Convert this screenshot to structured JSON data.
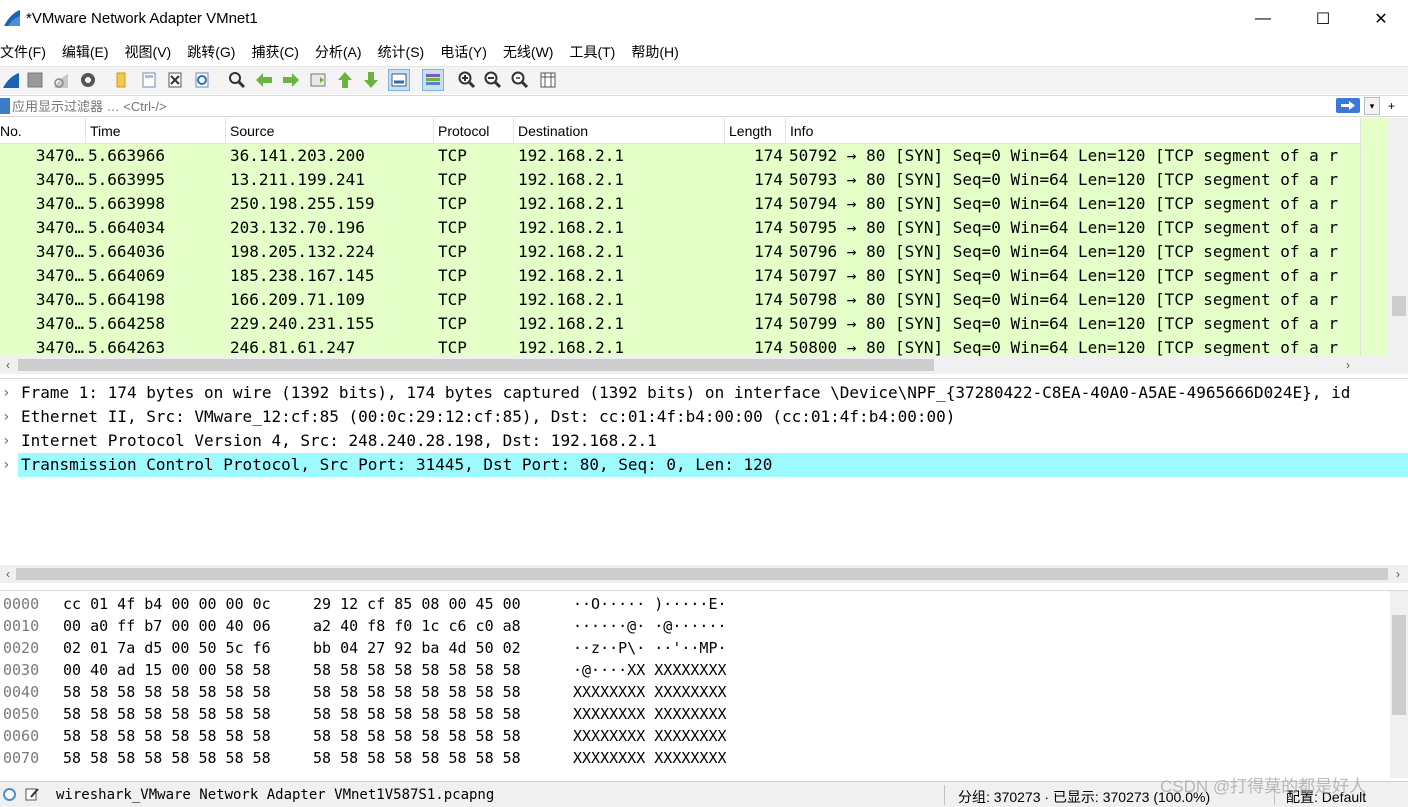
{
  "window": {
    "title": "*VMware Network Adapter VMnet1",
    "minimize": "—",
    "maximize": "☐",
    "close": "✕"
  },
  "menu": [
    "文件(F)",
    "编辑(E)",
    "视图(V)",
    "跳转(G)",
    "捕获(C)",
    "分析(A)",
    "统计(S)",
    "电话(Y)",
    "无线(W)",
    "工具(T)",
    "帮助(H)"
  ],
  "toolbar": {
    "icons": [
      "shark-fin-start-icon",
      "stop-square-icon",
      "restart-fin-icon",
      "capture-options-gear-icon",
      "open-folder-icon",
      "save-file-icon",
      "close-file-icon",
      "reload-icon",
      "find-packet-icon",
      "go-back-icon",
      "go-forward-icon",
      "go-to-packet-icon",
      "go-first-icon",
      "go-last-icon",
      "auto-scroll-icon",
      "colorize-icon",
      "zoom-in-icon",
      "zoom-out-icon",
      "normal-size-icon",
      "resize-columns-icon"
    ]
  },
  "filter": {
    "placeholder": "应用显示过滤器 … <Ctrl-/>",
    "extra": "+"
  },
  "packet_list": {
    "columns": [
      "No.",
      "Time",
      "Source",
      "Protocol",
      "Destination",
      "Length",
      "Info"
    ],
    "rows": [
      {
        "no": "3470…",
        "time": "5.663966",
        "source": "36.141.203.200",
        "protocol": "TCP",
        "destination": "192.168.2.1",
        "length": "174",
        "info": "50792 → 80 [SYN] Seq=0 Win=64 Len=120 [TCP segment of a r"
      },
      {
        "no": "3470…",
        "time": "5.663995",
        "source": "13.211.199.241",
        "protocol": "TCP",
        "destination": "192.168.2.1",
        "length": "174",
        "info": "50793 → 80 [SYN] Seq=0 Win=64 Len=120 [TCP segment of a r"
      },
      {
        "no": "3470…",
        "time": "5.663998",
        "source": "250.198.255.159",
        "protocol": "TCP",
        "destination": "192.168.2.1",
        "length": "174",
        "info": "50794 → 80 [SYN] Seq=0 Win=64 Len=120 [TCP segment of a r"
      },
      {
        "no": "3470…",
        "time": "5.664034",
        "source": "203.132.70.196",
        "protocol": "TCP",
        "destination": "192.168.2.1",
        "length": "174",
        "info": "50795 → 80 [SYN] Seq=0 Win=64 Len=120 [TCP segment of a r"
      },
      {
        "no": "3470…",
        "time": "5.664036",
        "source": "198.205.132.224",
        "protocol": "TCP",
        "destination": "192.168.2.1",
        "length": "174",
        "info": "50796 → 80 [SYN] Seq=0 Win=64 Len=120 [TCP segment of a r"
      },
      {
        "no": "3470…",
        "time": "5.664069",
        "source": "185.238.167.145",
        "protocol": "TCP",
        "destination": "192.168.2.1",
        "length": "174",
        "info": "50797 → 80 [SYN] Seq=0 Win=64 Len=120 [TCP segment of a r"
      },
      {
        "no": "3470…",
        "time": "5.664198",
        "source": "166.209.71.109",
        "protocol": "TCP",
        "destination": "192.168.2.1",
        "length": "174",
        "info": "50798 → 80 [SYN] Seq=0 Win=64 Len=120 [TCP segment of a r"
      },
      {
        "no": "3470…",
        "time": "5.664258",
        "source": "229.240.231.155",
        "protocol": "TCP",
        "destination": "192.168.2.1",
        "length": "174",
        "info": "50799 → 80 [SYN] Seq=0 Win=64 Len=120 [TCP segment of a r"
      },
      {
        "no": "3470…",
        "time": "5.664263",
        "source": "246.81.61.247",
        "protocol": "TCP",
        "destination": "192.168.2.1",
        "length": "174",
        "info": "50800 → 80 [SYN] Seq=0 Win=64 Len=120 [TCP segment of a r"
      }
    ],
    "row_color": "#e4ffc7"
  },
  "details": {
    "rows": [
      {
        "text": "Frame 1: 174 bytes on wire (1392 bits), 174 bytes captured (1392 bits) on interface \\Device\\NPF_{37280422-C8EA-40A0-A5AE-4965666D024E}, id",
        "selected": false
      },
      {
        "text": "Ethernet II, Src: VMware_12:cf:85 (00:0c:29:12:cf:85), Dst: cc:01:4f:b4:00:00 (cc:01:4f:b4:00:00)",
        "selected": false
      },
      {
        "text": "Internet Protocol Version 4, Src: 248.240.28.198, Dst: 192.168.2.1",
        "selected": false
      },
      {
        "text": "Transmission Control Protocol, Src Port: 31445, Dst Port: 80, Seq: 0, Len: 120",
        "selected": true
      }
    ],
    "selected_color": "#9dfbff"
  },
  "bytes": {
    "rows": [
      {
        "offset": "0000",
        "hex1": "cc 01 4f b4 00 00 00 0c",
        "hex2": "29 12 cf 85 08 00 45 00",
        "ascii": "··O····· )·····E·"
      },
      {
        "offset": "0010",
        "hex1": "00 a0 ff b7 00 00 40 06",
        "hex2": "a2 40 f8 f0 1c c6 c0 a8",
        "ascii": "······@· ·@······"
      },
      {
        "offset": "0020",
        "hex1": "02 01 7a d5 00 50 5c f6",
        "hex2": "bb 04 27 92 ba 4d 50 02",
        "ascii": "··z··P\\· ··'··MP·"
      },
      {
        "offset": "0030",
        "hex1": "00 40 ad 15 00 00 58 58",
        "hex2": "58 58 58 58 58 58 58 58",
        "ascii": "·@····XX XXXXXXXX"
      },
      {
        "offset": "0040",
        "hex1": "58 58 58 58 58 58 58 58",
        "hex2": "58 58 58 58 58 58 58 58",
        "ascii": "XXXXXXXX XXXXXXXX"
      },
      {
        "offset": "0050",
        "hex1": "58 58 58 58 58 58 58 58",
        "hex2": "58 58 58 58 58 58 58 58",
        "ascii": "XXXXXXXX XXXXXXXX"
      },
      {
        "offset": "0060",
        "hex1": "58 58 58 58 58 58 58 58",
        "hex2": "58 58 58 58 58 58 58 58",
        "ascii": "XXXXXXXX XXXXXXXX"
      },
      {
        "offset": "0070",
        "hex1": "58 58 58 58 58 58 58 58",
        "hex2": "58 58 58 58 58 58 58 58",
        "ascii": "XXXXXXXX XXXXXXXX"
      }
    ]
  },
  "status": {
    "file": "wireshark_VMware Network Adapter VMnet1V587S1.pcapng",
    "stats": "分组: 370273 · 已显示: 370273 (100.0%)",
    "profile": "配置: Default"
  },
  "watermark": "CSDN @打得莫的都是好人"
}
